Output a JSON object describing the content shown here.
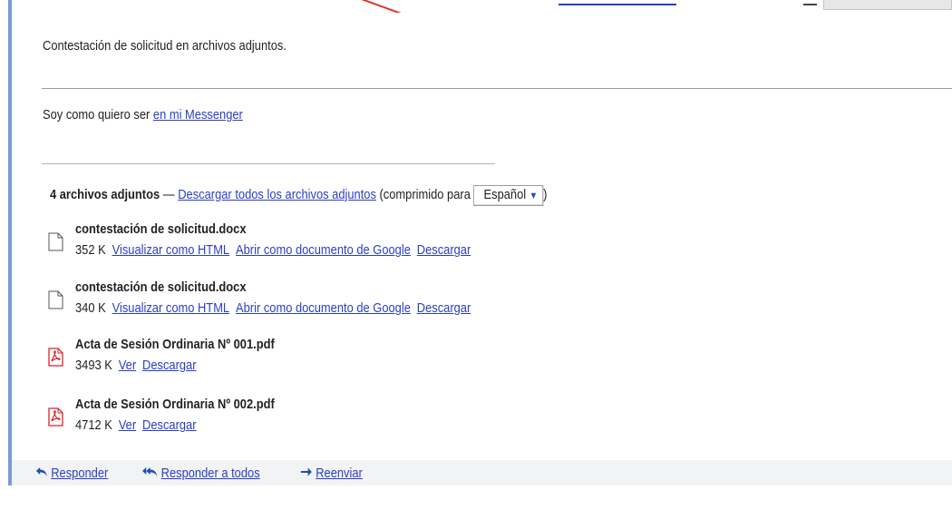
{
  "message": {
    "body": "Contestación de solicitud en archivos adjuntos.",
    "signature_prefix": "Soy como quiero ser",
    "signature_link": "en mi Messenger"
  },
  "attachments_header": {
    "count_label": "4 archivos adjuntos",
    "dash": " — ",
    "download_all": "Descargar todos los archivos adjuntos",
    "compressed_for": "(comprimido para",
    "language": "Español",
    "language_arrow": "▼",
    "close_paren": ")"
  },
  "attachments": [
    {
      "name": "contestación de solicitud.docx",
      "size": "352 K",
      "type": "doc",
      "actions": [
        "Visualizar como HTML",
        "Abrir como documento de Google",
        "Descargar"
      ]
    },
    {
      "name": "contestación de solicitud.docx",
      "size": "340 K",
      "type": "doc",
      "actions": [
        "Visualizar como HTML",
        "Abrir como documento de Google",
        "Descargar"
      ]
    },
    {
      "name": "Acta de Sesión Ordinaria Nº 001.pdf",
      "size": "3493 K",
      "type": "pdf",
      "actions": [
        "Ver",
        "Descargar"
      ]
    },
    {
      "name": "Acta de Sesión Ordinaria Nº 002.pdf",
      "size": "4712 K",
      "type": "pdf",
      "actions": [
        "Ver",
        "Descargar"
      ]
    }
  ],
  "actions": {
    "reply": "Responder",
    "reply_all": "Responder a todos",
    "forward": "Reenviar"
  },
  "icons": {
    "doc": "document-icon",
    "pdf": "pdf-icon",
    "reply": "reply-icon",
    "reply_all": "reply-all-icon",
    "forward": "forward-icon"
  },
  "colors": {
    "link": "#2a3fc7",
    "border_accent": "#7a9ad9",
    "action_bar": "#f2f3f4",
    "pdf_red": "#d8232a"
  }
}
